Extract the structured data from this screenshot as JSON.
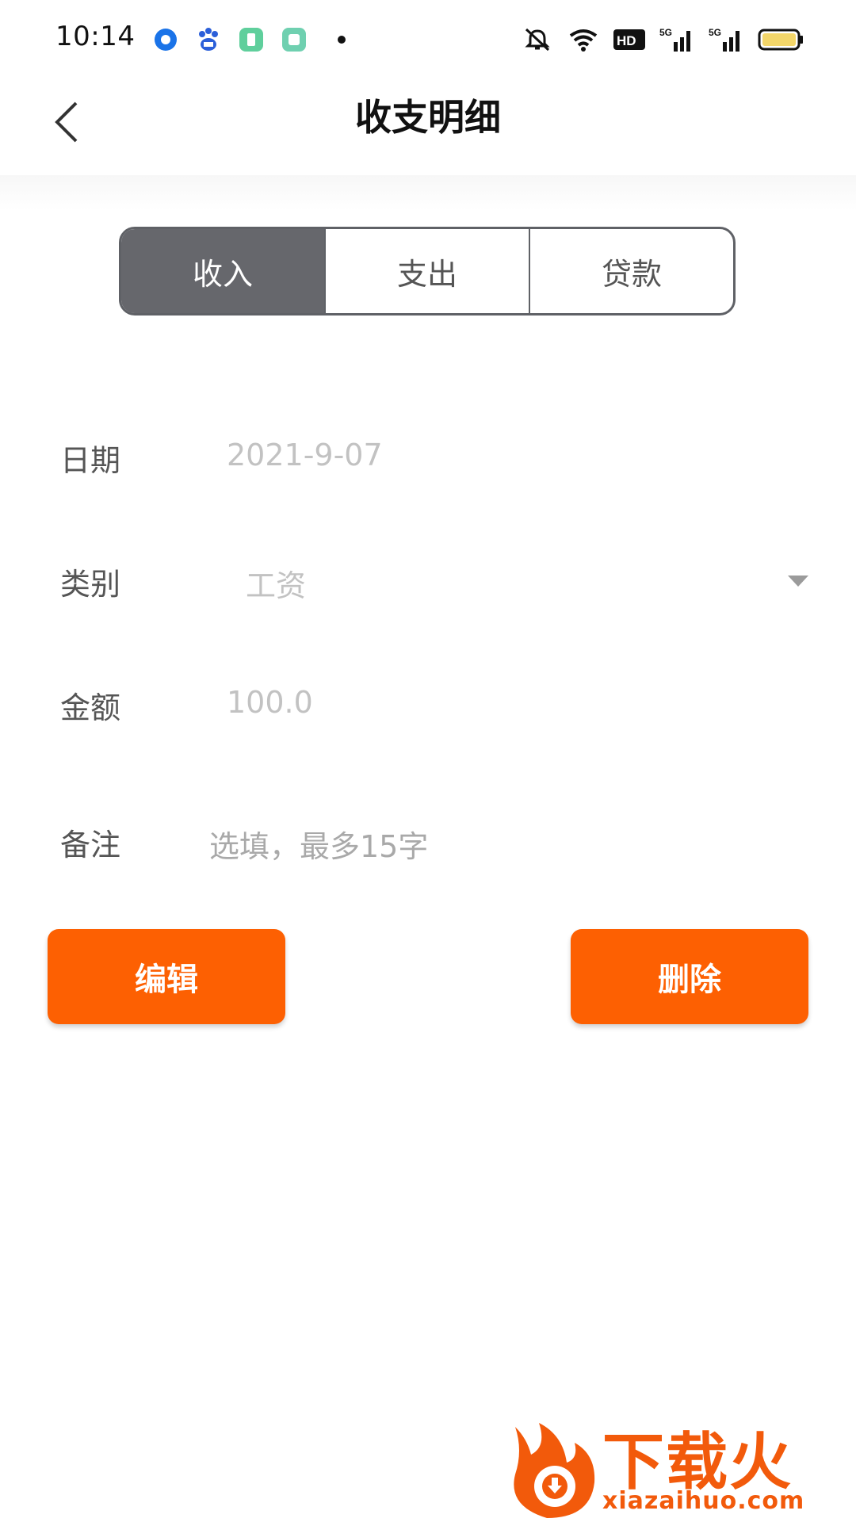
{
  "status_bar": {
    "time": "10:14",
    "notification_icons": [
      "generic-circle-icon",
      "baidu-paw-icon",
      "green-app-icon",
      "green-square-app-icon",
      "more-dot-icon"
    ],
    "system_icons": [
      "mute-icon",
      "wifi-icon",
      "hd-icon",
      "signal-5g-icon",
      "signal-5g-icon",
      "battery-icon"
    ],
    "hd_text": "HD",
    "network_text": "5G",
    "battery_color": "#f3d66a"
  },
  "header": {
    "title": "收支明细",
    "back_icon": "chevron-left-icon"
  },
  "tabs": [
    {
      "label": "收入",
      "active": true
    },
    {
      "label": "支出",
      "active": false
    },
    {
      "label": "贷款",
      "active": false
    }
  ],
  "form": {
    "date": {
      "label": "日期",
      "value": "2021-9-07"
    },
    "category": {
      "label": "类别",
      "value": "工资",
      "icon": "dropdown-arrow-icon"
    },
    "amount": {
      "label": "金额",
      "value": "100.0"
    },
    "note": {
      "label": "备注",
      "placeholder": "选填，最多15字"
    }
  },
  "actions": {
    "edit_label": "编辑",
    "delete_label": "删除"
  },
  "colors": {
    "accent": "#fd6002",
    "tab_active_bg": "#66676c",
    "tab_border": "#5f6166",
    "value_text": "#c2c2c2",
    "label_text": "#555555"
  },
  "watermark": {
    "brand": "下载火",
    "url": "xiazaihuo.com"
  }
}
